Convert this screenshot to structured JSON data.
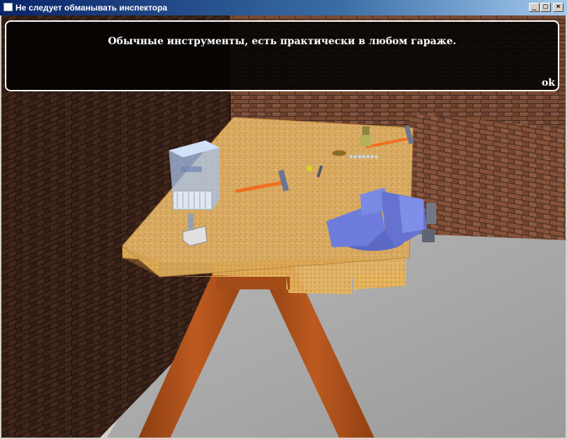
{
  "window": {
    "title": "Не следует обманывать инспектора",
    "controls": {
      "minimize": "_",
      "maximize": "□",
      "close": "×"
    }
  },
  "dialog": {
    "message": "Обычные инструменты, есть практически в любом гараже.",
    "ok_label": "ok"
  },
  "scene": {
    "objects": [
      "brick-wall-left",
      "brick-wall-back",
      "concrete-floor",
      "workbench",
      "trestle-leg",
      "bench-vise",
      "hammer",
      "screwdriver",
      "glass-box",
      "clamp",
      "oil-can",
      "bolts"
    ],
    "colors": {
      "dialog_bg": "#000000",
      "dialog_border": "#ffffff",
      "workbench": "#d9a95e",
      "vise": "#6f7fd8",
      "trestle": "#b3521a"
    }
  }
}
